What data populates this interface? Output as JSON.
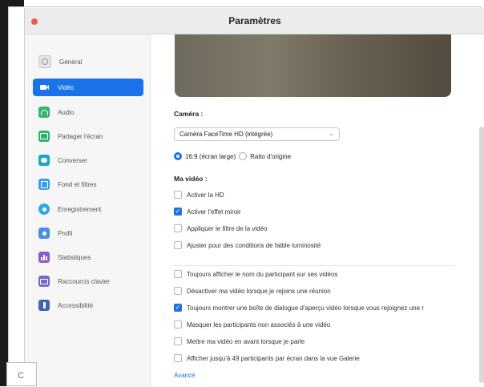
{
  "window": {
    "title": "Paramètres"
  },
  "sidebar": {
    "items": [
      {
        "label": "Général",
        "icon": "gear-icon",
        "color": "#d0d0d0"
      },
      {
        "label": "Vidéo",
        "icon": "video-camera-icon",
        "color": "#ffffff",
        "active": true
      },
      {
        "label": "Audio",
        "icon": "headphones-icon",
        "color": "#33b56b"
      },
      {
        "label": "Partager l'écran",
        "icon": "share-screen-icon",
        "color": "#2fb467"
      },
      {
        "label": "Converser",
        "icon": "chat-icon",
        "color": "#17a9c9"
      },
      {
        "label": "Fond et filtres",
        "icon": "background-filters-icon",
        "color": "#3a9ee8"
      },
      {
        "label": "Enregistrement",
        "icon": "record-icon",
        "color": "#2fa8e3"
      },
      {
        "label": "Profil",
        "icon": "profile-icon",
        "color": "#4a8fe2"
      },
      {
        "label": "Statistiques",
        "icon": "statistics-icon",
        "color": "#8a5cc7"
      },
      {
        "label": "Raccourcis clavier",
        "icon": "keyboard-icon",
        "color": "#7468c9"
      },
      {
        "label": "Accessibilité",
        "icon": "accessibility-icon",
        "color": "#3f64b5"
      }
    ]
  },
  "camera": {
    "label": "Caméra :",
    "selected": "Caméra FaceTime HD (intégrée)",
    "ratio_options": [
      {
        "label": "16:9 (écran large)",
        "selected": true
      },
      {
        "label": "Ratio d'origine",
        "selected": false
      }
    ]
  },
  "my_video": {
    "label": "Ma vidéo :",
    "options": [
      {
        "label": "Activer la HD",
        "checked": false
      },
      {
        "label": "Activer l'effet miroir",
        "checked": true
      },
      {
        "label": "Appliquer le filtre de la vidéo",
        "checked": false
      },
      {
        "label": "Ajuster pour des conditions de faible luminosité",
        "checked": false
      }
    ]
  },
  "more_options": [
    {
      "label": "Toujours afficher le nom du participant sur ses vidéos",
      "checked": false
    },
    {
      "label": "Désactiver ma vidéo lorsque je rejoins une réunion",
      "checked": false
    },
    {
      "label": "Toujours montrer une boîte de dialogue d'aperçu vidéo lorsque vous rejoignez une r",
      "checked": true
    },
    {
      "label": "Masquer les participants non associés à une vidéo",
      "checked": false
    },
    {
      "label": "Mettre ma vidéo en avant lorsque je parle",
      "checked": false
    },
    {
      "label": "Afficher jusqu'à 49 participants par écran dans la vue Galerie",
      "checked": false
    }
  ],
  "advanced_link": "Avancé",
  "corner_label": "C"
}
